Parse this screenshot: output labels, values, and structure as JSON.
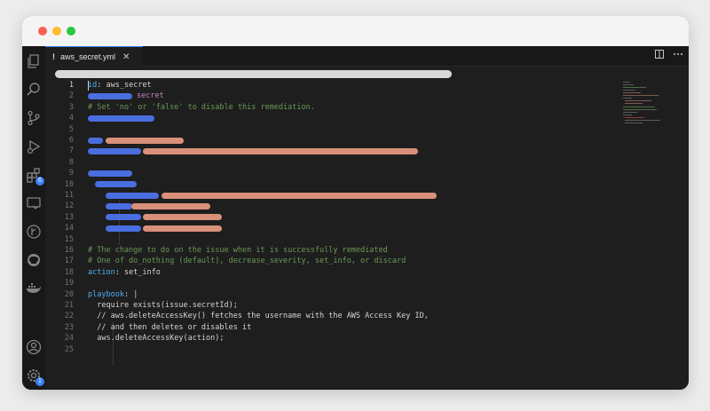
{
  "tab": {
    "icon": "!",
    "filename": "aws_secret.yml",
    "close": "✕"
  },
  "badges": {
    "extensions": "6",
    "settings": "1"
  },
  "lines": {
    "n1": "1",
    "n2": "2",
    "n3": "3",
    "n4": "4",
    "n5": "5",
    "n6": "6",
    "n7": "7",
    "n8": "8",
    "n9": "9",
    "n10": "10",
    "n11": "11",
    "n12": "12",
    "n13": "13",
    "n14": "14",
    "n15": "15",
    "n16": "16",
    "n17": "17",
    "n18": "18",
    "n19": "19",
    "n20": "20",
    "n21": "21",
    "n22": "22",
    "n23": "23",
    "n24": "24",
    "n25": "25"
  },
  "code": {
    "l1_key": "id",
    "l1_sep": ": ",
    "l1_val": "aws_secret",
    "l2_val": "secret",
    "l3": "# Set 'no' or 'false' to disable this remediation.",
    "l16": "# The change to do on the issue when it is successfully remediated",
    "l17": "# One of do_nothing (default), decrease_severity, set_info, or discard",
    "l18_key": "action",
    "l18_sep": ": ",
    "l18_val": "set_info",
    "l20_key": "playbook",
    "l20_sep": ": |",
    "l21": "  require exists(issue.secretId);",
    "l22": "  // aws.deleteAccessKey() fetches the username with the AWS Access Key ID,",
    "l23": "  // and then deletes or disables it",
    "l24": "  aws.deleteAccessKey(action);"
  },
  "colors": {
    "accent": "#3b82f6",
    "redaction_blue": "#4a6ee0",
    "redaction_orange": "#d9907a",
    "key": "#4fb0f4",
    "comment": "#6a9955"
  }
}
